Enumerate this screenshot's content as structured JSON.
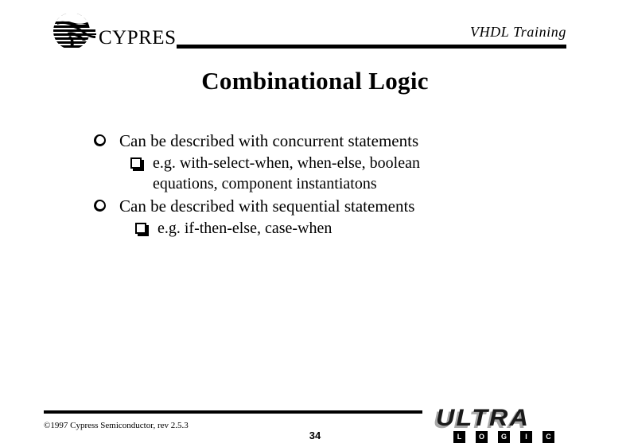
{
  "slide": {
    "header": {
      "title": "VHDL Training",
      "logo_name": "cypress-logo",
      "logo_text": "CYPRESS"
    },
    "title": "Combinational Logic",
    "bullets": [
      {
        "level": 1,
        "glyph": "circle-bullet-icon",
        "text": "Can be described with concurrent statements"
      },
      {
        "level": 2,
        "glyph": "square-bullet-icon",
        "text": "e.g. with-select-when, when-else, boolean equations, component instantiatons"
      },
      {
        "level": 1,
        "glyph": "circle-bullet-icon",
        "text": "Can be described with sequential statements"
      },
      {
        "level": 2,
        "glyph": "square-bullet-icon",
        "text": "e.g. if-then-else, case-when"
      }
    ],
    "footer": {
      "copyright": "©1997 Cypress Semiconductor, rev 2.5.3",
      "page_number": "34",
      "ultra_logic": {
        "wordmark": "ULTRA",
        "letters": [
          "L",
          "O",
          "G",
          "I",
          "C"
        ]
      }
    },
    "colors": {
      "background": "#ffffff",
      "text": "#000000",
      "rule": "#000000",
      "logo_shadow": "#a8a8a8"
    }
  }
}
